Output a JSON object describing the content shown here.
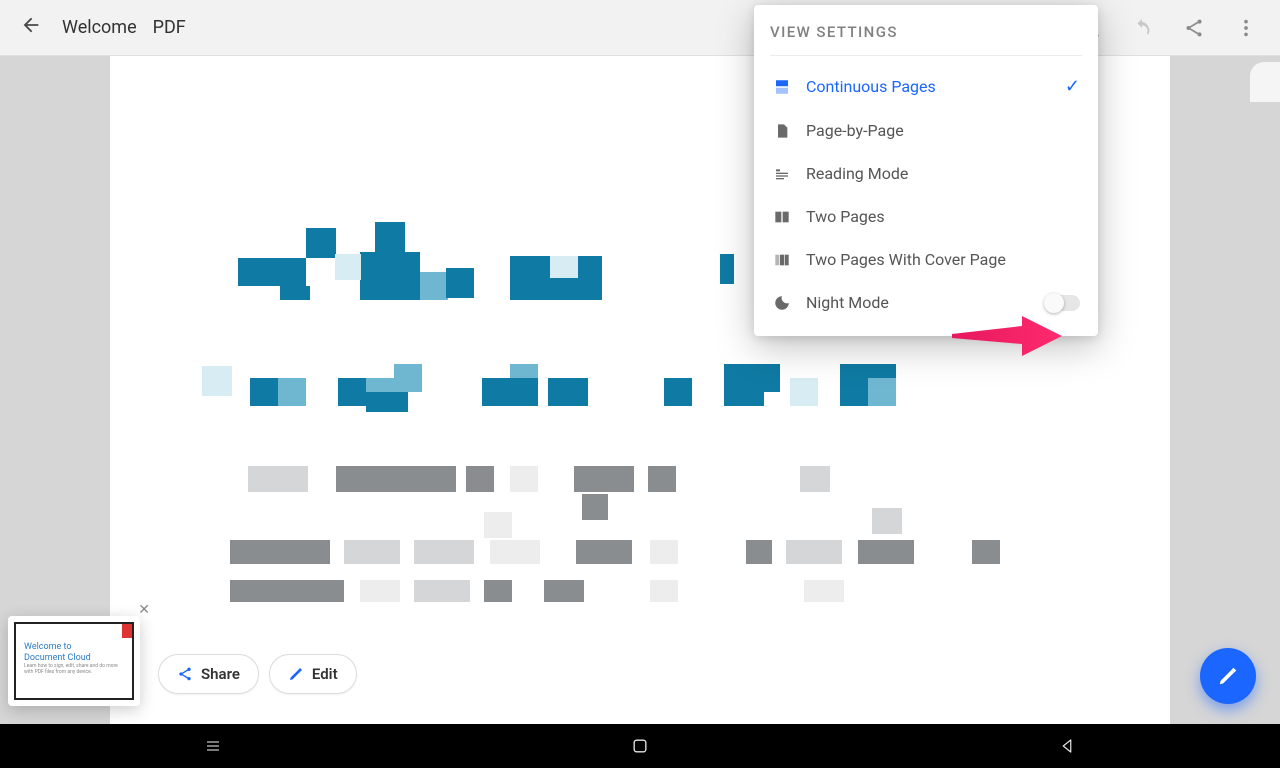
{
  "toolbar": {
    "doc_title": "Welcome",
    "doc_badge": "PDF"
  },
  "panel": {
    "title": "VIEW SETTINGS",
    "options": {
      "continuous": "Continuous Pages",
      "page_by_page": "Page-by-Page",
      "reading": "Reading Mode",
      "two_pages": "Two Pages",
      "two_pages_cover": "Two Pages With Cover Page",
      "night": "Night Mode"
    },
    "selected": "continuous",
    "night_mode_on": false
  },
  "actions": {
    "share": "Share",
    "edit": "Edit"
  },
  "thumbnail": {
    "title_line1": "Welcome to",
    "title_line2": "Document Cloud",
    "subtitle": "Learn how to sign, edit, share and do more with PDF files from any device."
  }
}
